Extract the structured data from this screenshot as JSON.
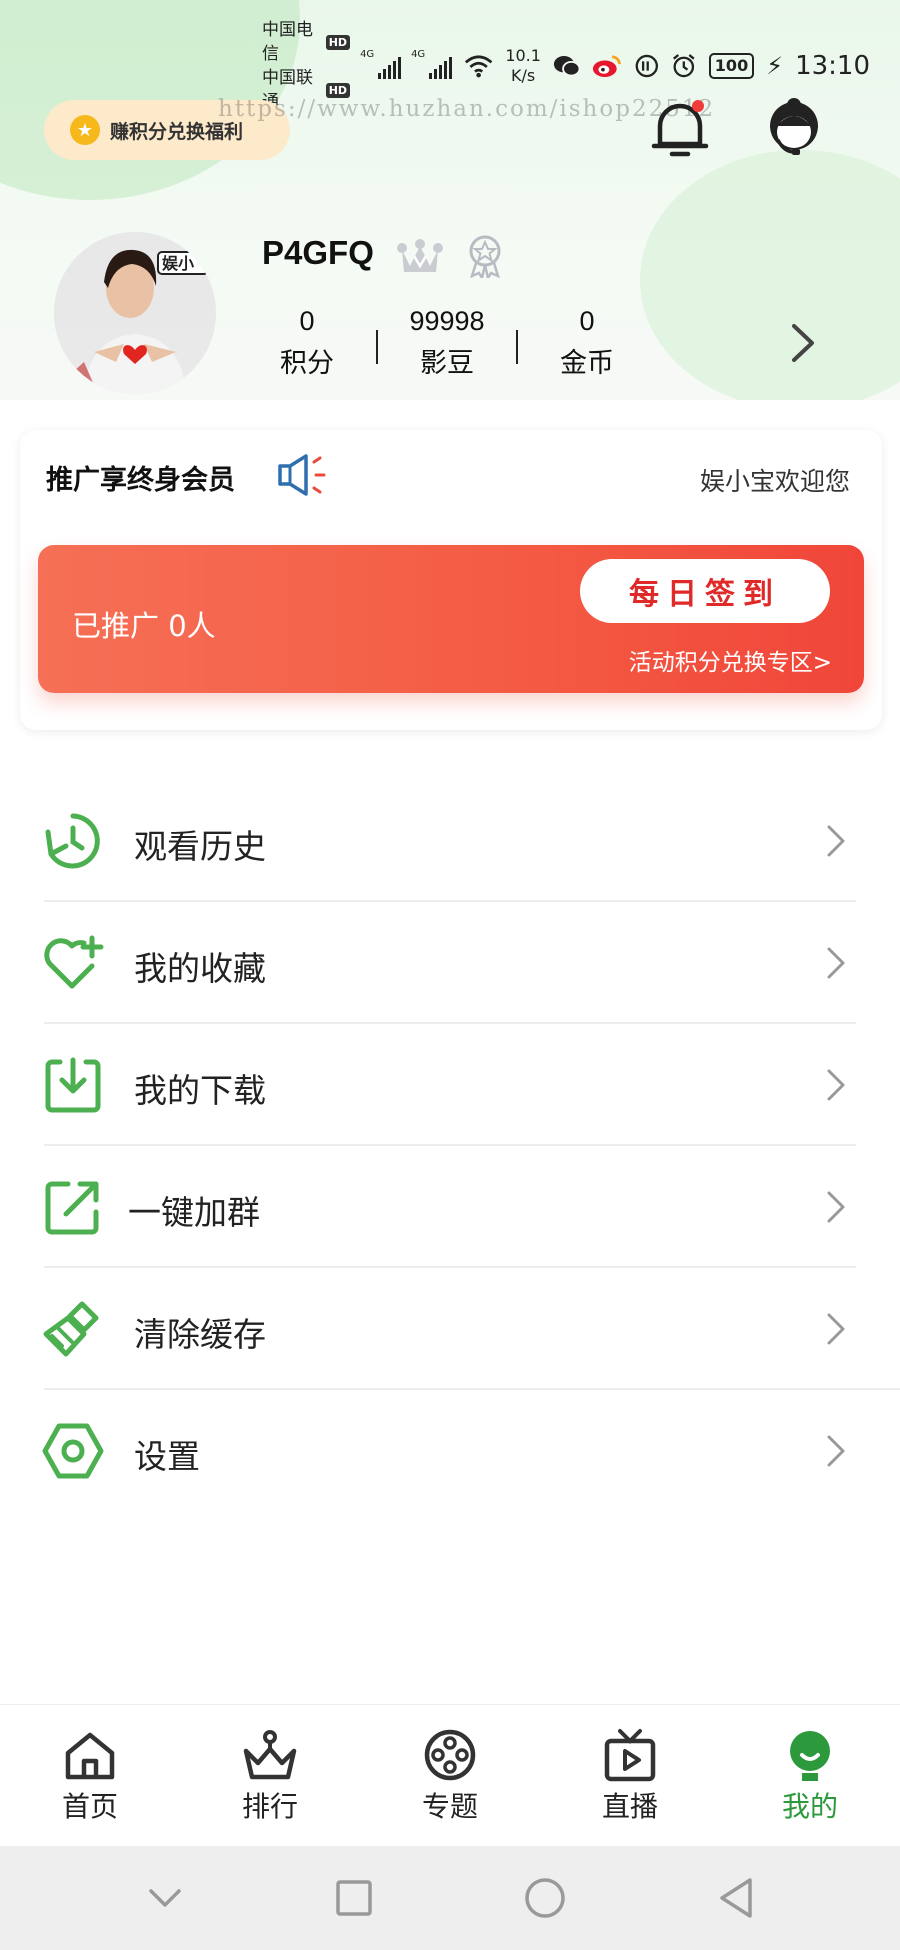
{
  "status_bar": {
    "carrier1": "中国电信",
    "carrier2": "中国联通",
    "hd_label": "HD",
    "net_type": "4G",
    "net_speed_value": "10.1",
    "net_speed_unit": "K/s",
    "battery": "100",
    "time": "13:10"
  },
  "header": {
    "points_banner": "赚积分兑换福利",
    "watermark": "https://www.huzhan.com/ishop22512",
    "has_unread_notification": true
  },
  "profile": {
    "username": "P4GFQ",
    "avatar_badge_text": "娱小",
    "stats": [
      {
        "value": "0",
        "label": "积分"
      },
      {
        "value": "99998",
        "label": "影豆"
      },
      {
        "value": "0",
        "label": "金币"
      }
    ]
  },
  "promo": {
    "title": "推广享终身会员",
    "welcome": "娱小宝欢迎您",
    "promoted_count": "已推广 0人",
    "checkin_button": "每日签到",
    "exchange_link": "活动积分兑换专区>"
  },
  "menu": {
    "items": [
      {
        "label": "观看历史",
        "icon": "history-icon"
      },
      {
        "label": "我的收藏",
        "icon": "favorite-heart-icon"
      },
      {
        "label": "我的下载",
        "icon": "download-icon"
      },
      {
        "label": "一键加群",
        "icon": "share-external-icon"
      },
      {
        "label": "清除缓存",
        "icon": "broom-icon"
      },
      {
        "label": "设置",
        "icon": "settings-hex-icon"
      }
    ]
  },
  "bottom_nav": {
    "items": [
      {
        "label": "首页",
        "icon": "home-icon"
      },
      {
        "label": "排行",
        "icon": "ranking-crown-icon"
      },
      {
        "label": "专题",
        "icon": "film-reel-icon"
      },
      {
        "label": "直播",
        "icon": "tv-play-icon"
      },
      {
        "label": "我的",
        "icon": "profile-icon"
      }
    ],
    "active_index": 4
  },
  "colors": {
    "accent_green": "#4caf50",
    "nav_active_green": "#2c9a3c",
    "promo_red": "#f45a43",
    "checkin_text_red": "#e02a2a",
    "points_pill_bg": "#fdeacb"
  }
}
